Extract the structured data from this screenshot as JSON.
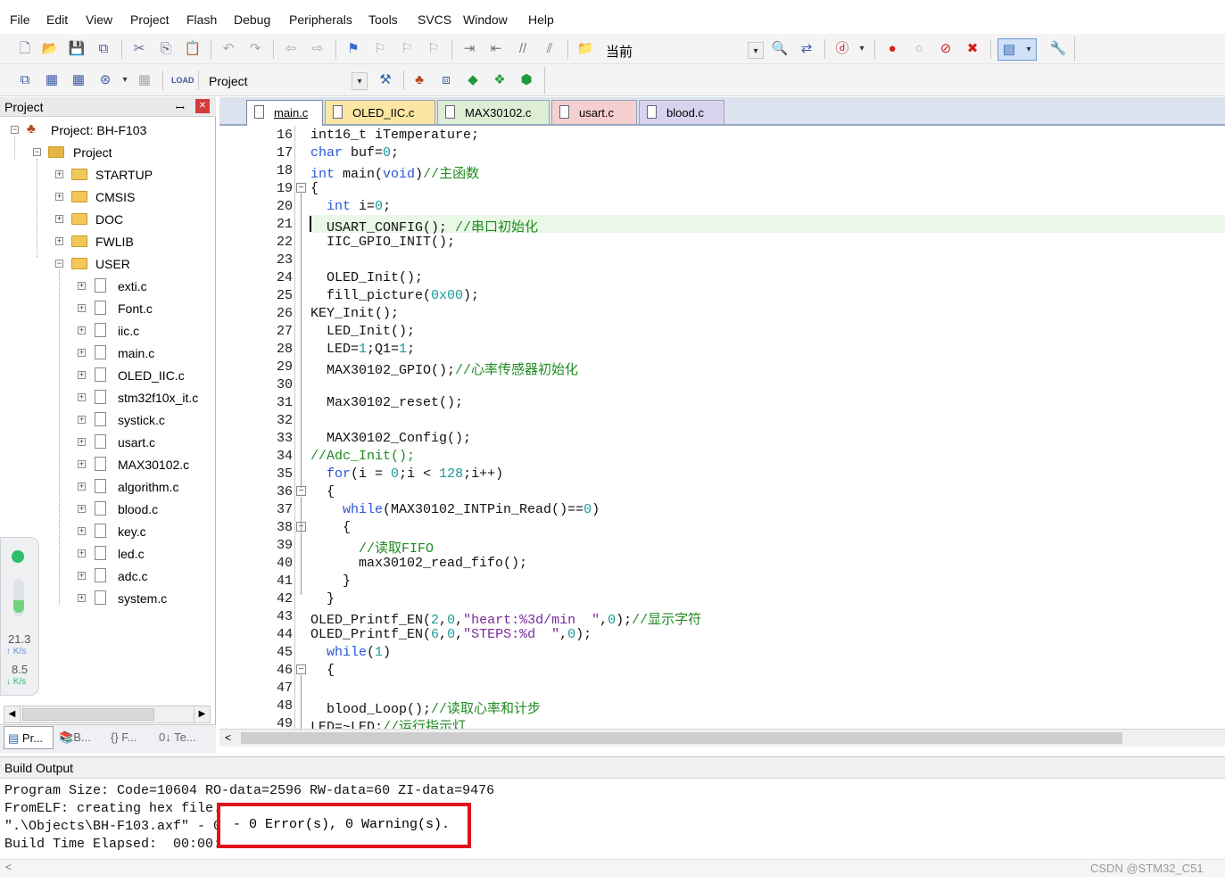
{
  "menu": [
    "File",
    "Edit",
    "View",
    "Project",
    "Flash",
    "Debug",
    "Peripherals",
    "Tools",
    "SVCS",
    "Window",
    "Help"
  ],
  "toolbar": {
    "target_combo": "当前",
    "project_combo": "Project"
  },
  "project_panel": {
    "title": "Project",
    "pin_glyph": "ꟷ",
    "close_glyph": "✕",
    "root_label": "Project: BH-F103",
    "group_label": "Project",
    "folders": [
      "STARTUP",
      "CMSIS",
      "DOC",
      "FWLIB",
      "USER"
    ],
    "files": [
      "exti.c",
      "Font.c",
      "iic.c",
      "main.c",
      "OLED_IIC.c",
      "stm32f10x_it.c",
      "systick.c",
      "usart.c",
      "MAX30102.c",
      "algorithm.c",
      "blood.c",
      "key.c",
      "led.c",
      "adc.c",
      "system.c"
    ],
    "bottom_tabs": [
      "Pr...",
      "B...",
      "{} F...",
      "0↓ Te..."
    ]
  },
  "net_widget": {
    "up_value": "21.3",
    "up_unit": "↑ K/s",
    "down_value": "8.5",
    "down_unit": "↓ K/s"
  },
  "editor": {
    "tabs": [
      {
        "label": "main.c",
        "color": "#ffffff",
        "active": true
      },
      {
        "label": "OLED_IIC.c",
        "color": "#fbe6a4",
        "active": false
      },
      {
        "label": "MAX30102.c",
        "color": "#ddeed5",
        "active": false
      },
      {
        "label": "usart.c",
        "color": "#f6cfd1",
        "active": false
      },
      {
        "label": "blood.c",
        "color": "#d9d2ee",
        "active": false
      }
    ],
    "line_numbers": [
      "16",
      "17",
      "18",
      "19",
      "20",
      "21",
      "22",
      "23",
      "24",
      "25",
      "26",
      "27",
      "28",
      "29",
      "30",
      "31",
      "32",
      "33",
      "34",
      "35",
      "36",
      "37",
      "38",
      "39",
      "40",
      "41",
      "42",
      "43",
      "44",
      "45",
      "46",
      "47",
      "48",
      "49"
    ],
    "highlight_line": "21"
  },
  "build_output": {
    "title": "Build Output",
    "lines": [
      "Program Size: Code=10604 RO-data=2596 RW-data=60 ZI-data=9476",
      "FromELF: creating hex file...",
      "\".\\Objects\\BH-F103.axf\" - 0 Error(s), 0 Warning(s).",
      "Build Time Elapsed:  00:00:03"
    ],
    "highlighted_text": "- 0 Error(s), 0 Warning(s)."
  },
  "watermark": "CSDN @STM32_C51",
  "colors": {
    "keyword": "#2a56d8",
    "number": "#1a9a9a",
    "string": "#7a2a9a",
    "comment": "#1f8a1f",
    "current_line": "#e9f8e7",
    "error_box": "#e0131a"
  }
}
